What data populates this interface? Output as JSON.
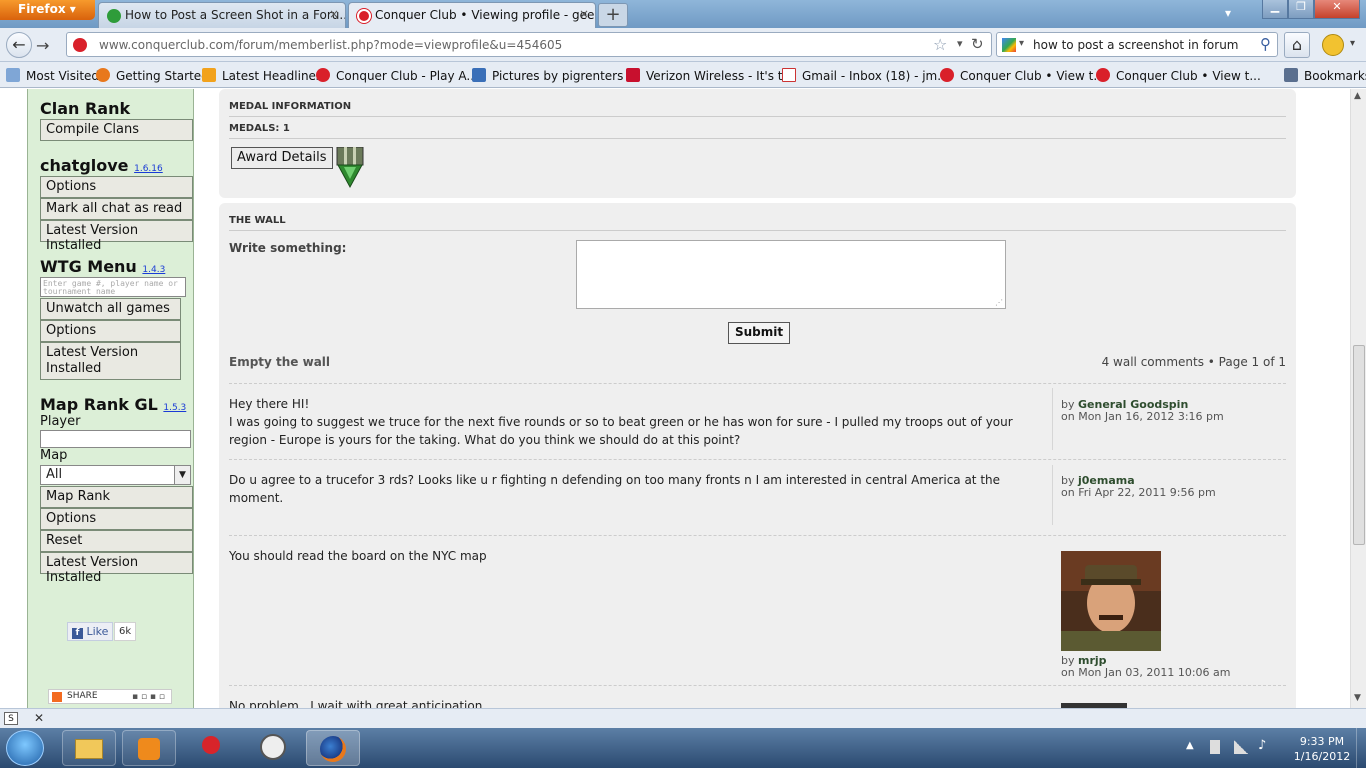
{
  "browser": {
    "app_button": "Firefox",
    "tabs": [
      {
        "label": "How to Post a Screen Shot in a Foru...",
        "close": "×"
      },
      {
        "label": "Conquer Club • Viewing profile - gee...",
        "close": "×"
      }
    ],
    "new_tab": "+",
    "url": "www.conquerclub.com/forum/memberlist.php?mode=viewprofile&u=454605",
    "search_value": "how to post a screenshot in forum",
    "bookmarks": [
      "Most Visited",
      "Getting Started",
      "Latest Headlines",
      "Conquer Club - Play A...",
      "Pictures by pigrenters ...",
      "Verizon Wireless - It's t...",
      "Gmail - Inbox (18) - jm...",
      "Conquer Club • View t...",
      "Conquer Club • View t..."
    ],
    "bookmarks_menu": "Bookmarks",
    "colors": {
      "firefox_orange": "#e8781c",
      "sidebar_green": "#dcefd7"
    }
  },
  "sidebar": {
    "clan_rank": {
      "title": "Clan Rank",
      "buttons": [
        "Compile Clans"
      ]
    },
    "chatglove": {
      "title": "chatglove",
      "version": "1.6.16",
      "buttons": [
        "Options",
        "Mark all chat as read",
        "Latest Version Installed"
      ]
    },
    "wtg": {
      "title": "WTG Menu",
      "version": "1.4.3",
      "input_placeholder": "Enter game #, player name or tournament name",
      "buttons": [
        "Unwatch all games",
        "Options"
      ],
      "latest": "Latest Version Installed"
    },
    "maprank": {
      "title": "Map Rank GL",
      "version": "1.5.3",
      "player_label": "Player",
      "map_label": "Map",
      "map_selected": "All",
      "buttons": [
        "Map Rank",
        "Options",
        "Reset",
        "Latest Version Installed"
      ]
    },
    "like": {
      "label": "Like",
      "count": "6k"
    },
    "share": "SHARE"
  },
  "medal": {
    "heading": "MEDAL INFORMATION",
    "count_label": "MEDALS: 1",
    "award_button": "Award Details"
  },
  "wall": {
    "heading": "THE WALL",
    "write_label": "Write something:",
    "submit": "Submit",
    "empty_link": "Empty the wall",
    "pagination": "4 wall comments • Page 1 of 1",
    "comments": [
      {
        "lines": [
          "Hey there HI!",
          "I was going to suggest we truce for the next five rounds or so to beat green or he has won for sure - I pulled my troops out of your region - Europe is yours for the taking. What do you think we should do at this point?"
        ],
        "by": "by",
        "author": "General Goodspin",
        "date": "on Mon Jan 16, 2012 3:16 pm"
      },
      {
        "lines": [
          "Do u agree to a trucefor 3 rds? Looks like u r fighting n defending on too many fronts n I am interested in central America at the moment."
        ],
        "by": "by",
        "author": "j0emama",
        "date": "on Fri Apr 22, 2011 9:56 pm"
      },
      {
        "lines": [
          "You should read the board on the NYC map"
        ],
        "by": "by",
        "author": "mrjp",
        "date": "on Mon Jan 03, 2011 10:06 am"
      },
      {
        "lines": [
          "No problem...I wait with great anticipation"
        ]
      }
    ]
  },
  "taskbar": {
    "time": "9:33 PM",
    "date": "1/16/2012"
  }
}
